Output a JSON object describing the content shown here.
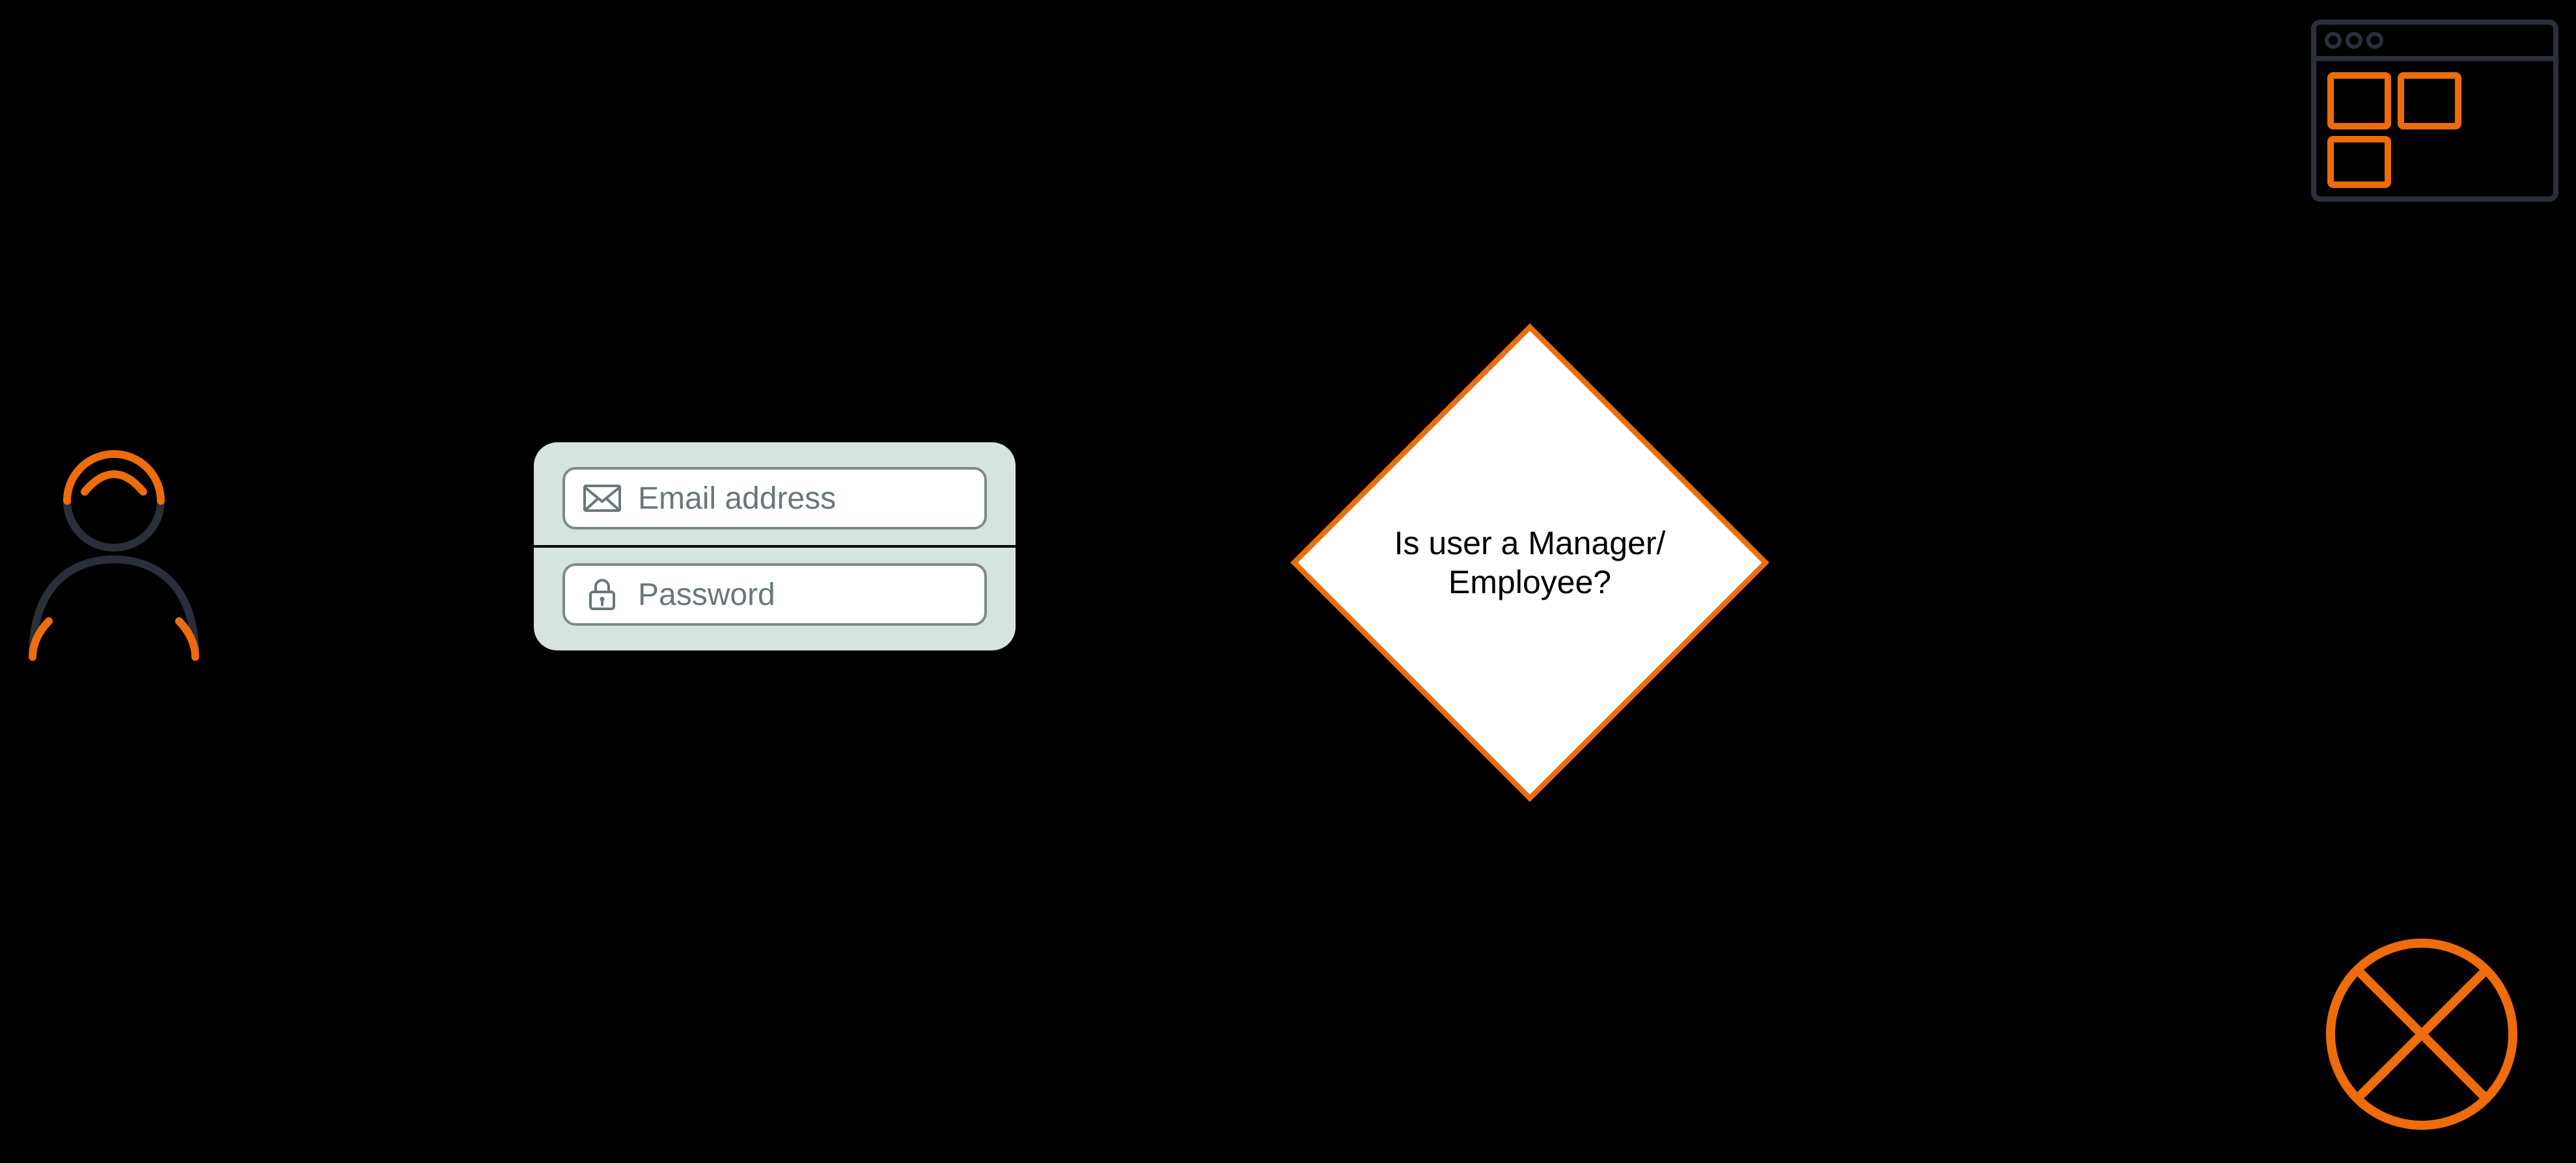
{
  "colors": {
    "accent": "#ee6c0c",
    "outline_dark": "#2a2f3a",
    "form_bg": "#d7e3df",
    "form_border": "#7b8a8a",
    "form_text": "#69777a"
  },
  "nodes": {
    "user": {
      "type": "actor-person"
    },
    "login_form": {
      "type": "login-form",
      "fields": [
        {
          "icon": "envelope-icon",
          "label": "Email address"
        },
        {
          "icon": "lock-icon",
          "label": "Password"
        }
      ]
    },
    "decision": {
      "type": "decision-diamond",
      "text": "Is user a Manager/ Employee?"
    },
    "dashboard": {
      "type": "app-window"
    },
    "denied": {
      "type": "circle-cross"
    }
  }
}
